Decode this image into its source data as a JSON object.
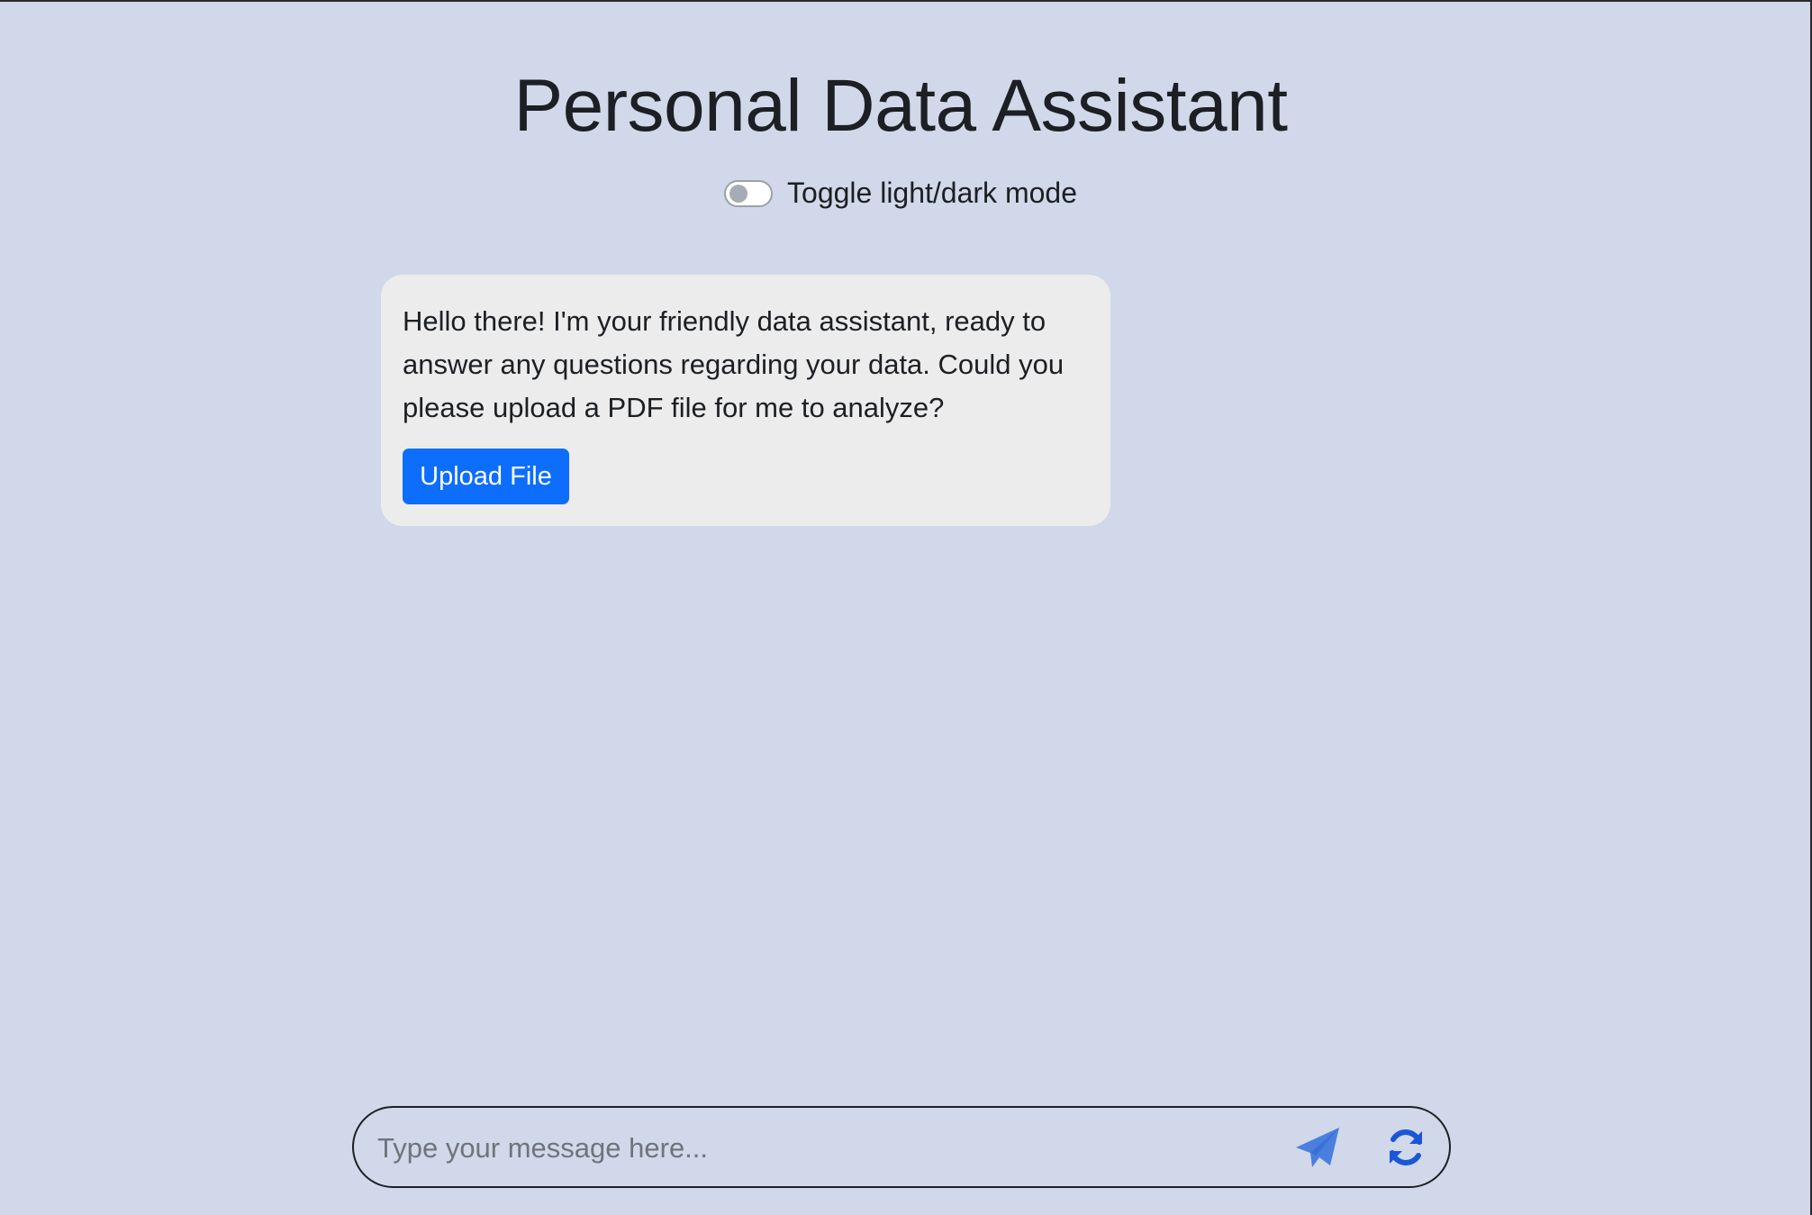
{
  "header": {
    "title": "Personal Data Assistant"
  },
  "mode_toggle": {
    "label": "Toggle light/dark mode",
    "checked": false
  },
  "chat": {
    "messages": [
      {
        "sender": "assistant",
        "text": "Hello there! I'm your friendly data assistant, ready to answer any questions regarding your data. Could you please upload a PDF file for me to analyze?",
        "action_label": "Upload File"
      }
    ]
  },
  "composer": {
    "placeholder": "Type your message here...",
    "value": "",
    "send_icon": "paper-plane-icon",
    "refresh_icon": "refresh-icon"
  },
  "colors": {
    "background": "#d1d8e9",
    "bubble": "#ececec",
    "primary_button": "#0d6efd",
    "send_icon": "#4a7fe0",
    "refresh_icon": "#1a56d9"
  }
}
